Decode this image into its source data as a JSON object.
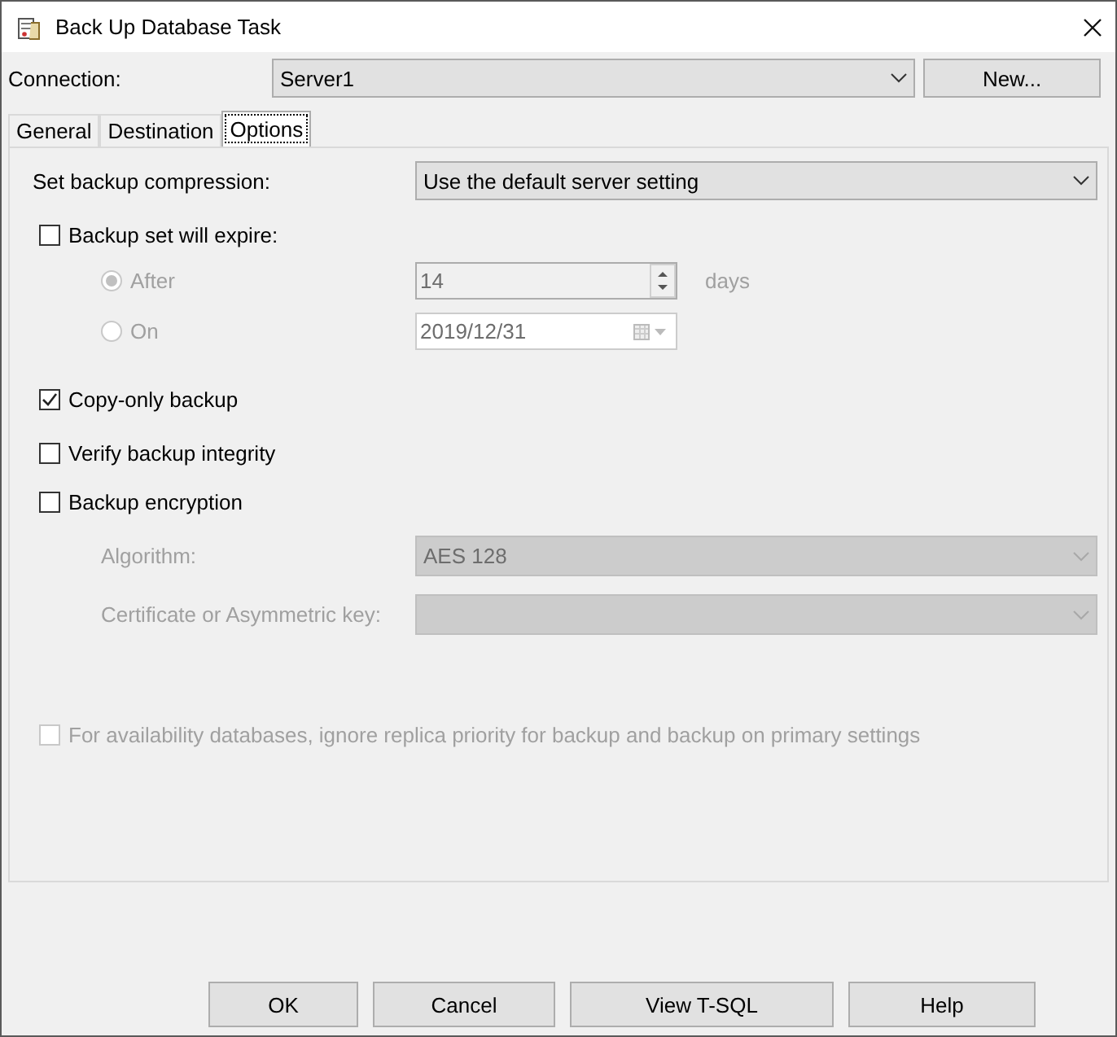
{
  "window": {
    "title": "Back Up Database Task"
  },
  "connection": {
    "label": "Connection:",
    "value": "Server1",
    "button": "New..."
  },
  "tabs": [
    {
      "label": "General",
      "selected": false
    },
    {
      "label": "Destination",
      "selected": false
    },
    {
      "label": "Options",
      "selected": true
    }
  ],
  "compression": {
    "label": "Set backup compression:",
    "value": "Use the default server setting",
    "disabled": false
  },
  "expire": {
    "label": "Backup set will expire:",
    "checked": false,
    "disabled": false
  },
  "expire_options": [
    {
      "label": "After",
      "selected": true,
      "disabled": true,
      "kind": "spinner",
      "value": "14",
      "unit": "days"
    },
    {
      "label": "On",
      "selected": false,
      "disabled": true,
      "kind": "date",
      "value": "2019/12/31"
    }
  ],
  "copy_only": {
    "label": "Copy-only backup",
    "checked": true,
    "disabled": false
  },
  "verify": {
    "label": "Verify backup integrity",
    "checked": false,
    "disabled": false
  },
  "encryption": {
    "label": "Backup encryption",
    "checked": false,
    "disabled": false
  },
  "encryption_fields": [
    {
      "label": "Algorithm:",
      "value": "AES 128",
      "disabled": true
    },
    {
      "label": "Certificate or Asymmetric key:",
      "disabled": true
    }
  ],
  "availability": {
    "label": "For availability databases, ignore replica priority for backup and backup on primary settings",
    "checked": false,
    "disabled": true
  },
  "buttons": [
    "OK",
    "Cancel",
    "View T-SQL",
    "Help"
  ]
}
